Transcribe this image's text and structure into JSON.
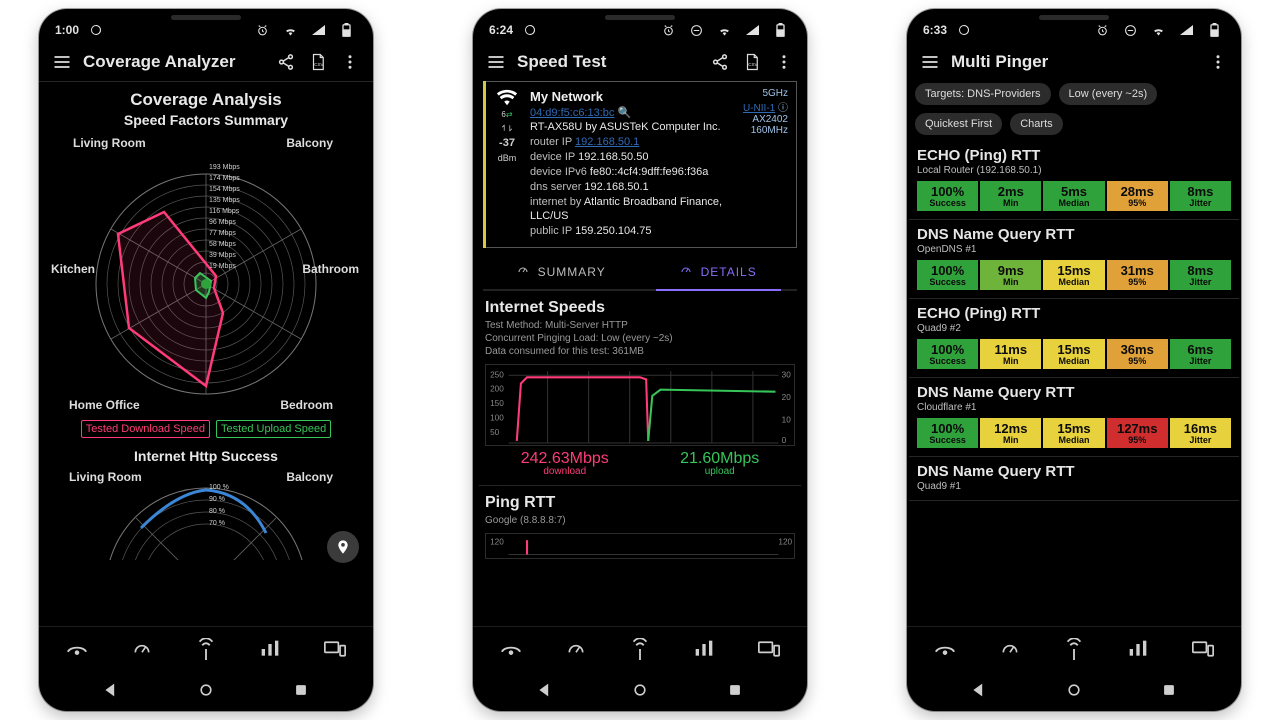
{
  "phone1": {
    "status_time": "1:00",
    "appbar_title": "Coverage Analyzer",
    "section_title": "Coverage Analysis",
    "section_sub": "Speed Factors Summary",
    "radar_axes": [
      "Living Room",
      "Balcony",
      "Bathroom",
      "Bedroom",
      "Home Office",
      "Kitchen"
    ],
    "radar_ticks": [
      "193 Mbps",
      "174 Mbps",
      "154 Mbps",
      "135 Mbps",
      "116 Mbps",
      "96 Mbps",
      "77 Mbps",
      "58 Mbps",
      "39 Mbps",
      "19 Mbps"
    ],
    "legend_dl": "Tested Download Speed",
    "legend_ul": "Tested Upload Speed",
    "section2_title": "Internet Http Success",
    "section2_axes": [
      "Living Room",
      "Balcony"
    ],
    "section2_ticks": [
      "100 %",
      "90 %",
      "80 %",
      "70 %"
    ]
  },
  "phone2": {
    "status_time": "6:24",
    "appbar_title": "Speed Test",
    "net": {
      "name": "My Network",
      "mac": "04:d9:f5:c6:13:bc",
      "device": "RT-AX58U by ASUSTeK Computer Inc.",
      "router_ip_label": "router IP ",
      "router_ip": "192.168.50.1",
      "device_ip_label": "device IP ",
      "device_ip": "192.168.50.50",
      "device_ipv6_label": "device IPv6 ",
      "device_ipv6": "fe80::4cf4:9dff:fe96:f36a",
      "dns_label": "dns server ",
      "dns": "192.168.50.1",
      "isp_label": "internet by ",
      "isp": "Atlantic Broadband Finance, LLC/US",
      "public_label": "public IP ",
      "public_ip": "159.250.104.75",
      "signal": "-37",
      "signal_unit": "dBm",
      "band": "5GHz",
      "unii": "U-NII-1",
      "chipset": "AX2402",
      "bw": "160MHz"
    },
    "tab_summary": "SUMMARY",
    "tab_details": "DETAILS",
    "speeds_title": "Internet Speeds",
    "speeds_meta1": "Test Method: Multi-Server HTTP",
    "speeds_meta2": "Concurrent Pinging Load: Low (every ~2s)",
    "speeds_meta3": "Data consumed for this test: 361MB",
    "dl_value": "242.63Mbps",
    "dl_label": "download",
    "ul_value": "21.60Mbps",
    "ul_label": "upload",
    "ping_title": "Ping RTT",
    "ping_target": "Google (8.8.8.8:7)",
    "y_dl": [
      "250",
      "200",
      "150",
      "100",
      "50"
    ],
    "y_ul": [
      "30",
      "20",
      "10",
      "0"
    ],
    "ping_scale": "120"
  },
  "phone3": {
    "status_time": "6:33",
    "appbar_title": "Multi Pinger",
    "chips": [
      "Targets: DNS-Providers",
      "Low (every ~2s)",
      "Quickest First",
      "Charts"
    ],
    "cells_header": [
      "Success",
      "Min",
      "Median",
      "95%",
      "Jitter"
    ],
    "blocks": [
      {
        "title": "ECHO (Ping) RTT",
        "sub": "Local Router (192.168.50.1)",
        "cells": [
          {
            "v": "100%",
            "cls": "c-green"
          },
          {
            "v": "2ms",
            "cls": "c-green"
          },
          {
            "v": "5ms",
            "cls": "c-green"
          },
          {
            "v": "28ms",
            "cls": "c-orange"
          },
          {
            "v": "8ms",
            "cls": "c-green"
          }
        ]
      },
      {
        "title": "DNS Name Query RTT",
        "sub": "OpenDNS #1",
        "cells": [
          {
            "v": "100%",
            "cls": "c-green"
          },
          {
            "v": "9ms",
            "cls": "c-lgreen"
          },
          {
            "v": "15ms",
            "cls": "c-yellow"
          },
          {
            "v": "31ms",
            "cls": "c-orange"
          },
          {
            "v": "8ms",
            "cls": "c-green"
          }
        ]
      },
      {
        "title": "ECHO (Ping) RTT",
        "sub": "Quad9 #2",
        "cells": [
          {
            "v": "100%",
            "cls": "c-green"
          },
          {
            "v": "11ms",
            "cls": "c-yellow"
          },
          {
            "v": "15ms",
            "cls": "c-yellow"
          },
          {
            "v": "36ms",
            "cls": "c-orange"
          },
          {
            "v": "6ms",
            "cls": "c-green"
          }
        ]
      },
      {
        "title": "DNS Name Query RTT",
        "sub": "Cloudflare #1",
        "cells": [
          {
            "v": "100%",
            "cls": "c-green"
          },
          {
            "v": "12ms",
            "cls": "c-yellow"
          },
          {
            "v": "15ms",
            "cls": "c-yellow"
          },
          {
            "v": "127ms",
            "cls": "c-red"
          },
          {
            "v": "16ms",
            "cls": "c-yellow"
          }
        ]
      },
      {
        "title": "DNS Name Query RTT",
        "sub": "Quad9 #1",
        "cells": []
      }
    ]
  },
  "chart_data": [
    {
      "type": "line",
      "title": "Internet Speeds",
      "series": [
        {
          "name": "download (Mbps)",
          "values": [
            30,
            240,
            240,
            243,
            242,
            0,
            0,
            0,
            0,
            0
          ],
          "color": "#ff3b7a"
        },
        {
          "name": "upload (Mbps)",
          "values": [
            0,
            0,
            0,
            0,
            0,
            21,
            22,
            21,
            22,
            21
          ],
          "color": "#37c559"
        }
      ],
      "x": [
        0,
        1,
        2,
        3,
        4,
        5,
        6,
        7,
        8,
        9
      ],
      "ylim_left": [
        0,
        250
      ],
      "ylim_right": [
        0,
        30
      ],
      "xlabel": "",
      "ylabel": "Mbps"
    },
    {
      "type": "radar",
      "title": "Coverage Analysis — Speed Factors Summary",
      "categories": [
        "Living Room",
        "Balcony",
        "Bathroom",
        "Bedroom",
        "Home Office",
        "Kitchen"
      ],
      "series": [
        {
          "name": "Tested Download Speed (Mbps)",
          "values": [
            145,
            20,
            10,
            60,
            180,
            155
          ],
          "color": "#ff3b7a"
        },
        {
          "name": "Tested Upload Speed (Mbps)",
          "values": [
            20,
            10,
            5,
            15,
            25,
            20
          ],
          "color": "#37c559"
        }
      ],
      "ylim": [
        0,
        193
      ],
      "ylabel": "Mbps"
    },
    {
      "type": "table",
      "title": "Multi Pinger results",
      "columns": [
        "Target",
        "Success",
        "Min",
        "Median",
        "95%",
        "Jitter"
      ],
      "rows": [
        [
          "Local Router (192.168.50.1)",
          "100%",
          "2ms",
          "5ms",
          "28ms",
          "8ms"
        ],
        [
          "OpenDNS #1",
          "100%",
          "9ms",
          "15ms",
          "31ms",
          "8ms"
        ],
        [
          "Quad9 #2",
          "100%",
          "11ms",
          "15ms",
          "36ms",
          "6ms"
        ],
        [
          "Cloudflare #1",
          "100%",
          "12ms",
          "15ms",
          "127ms",
          "16ms"
        ]
      ]
    }
  ]
}
